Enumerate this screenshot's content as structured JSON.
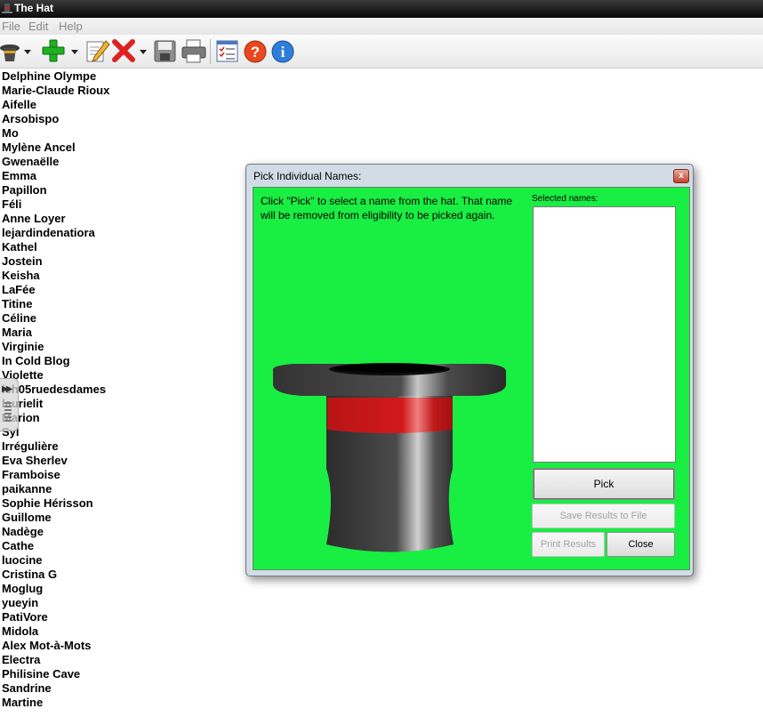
{
  "window": {
    "title": "The Hat"
  },
  "menu": [
    "File",
    "Edit",
    "Help"
  ],
  "toolbar": {
    "icons": [
      "hat-dropdown-icon",
      "add-icon",
      "edit-icon",
      "delete-icon",
      "save-icon",
      "print-icon",
      "checklist-icon",
      "help-icon",
      "info-icon"
    ]
  },
  "names": [
    "Delphine Olympe",
    "Marie-Claude Rioux",
    "Aifelle",
    "Arsobispo",
    "Mo",
    "Mylène Ancel",
    "Gwenaëlle",
    "Emma",
    "Papillon",
    "Féli",
    "Anne Loyer",
    "lejardindenatiora",
    "Kathel",
    "Jostein",
    "Keisha",
    "LaFée",
    "Titine",
    "Céline",
    "Maria",
    "Virginie",
    "In Cold Blog",
    "Violette",
    "ich05ruedesdames",
    "laurielit",
    "Marion",
    "Syl",
    "Irrégulière",
    "Eva Sherlev",
    "Framboise",
    "paikanne",
    "Sophie Hérisson",
    "Guillome",
    "Nadège",
    "Cathe",
    "luocine",
    "Cristina G",
    "Moglug",
    "yueyin",
    "PatiVore",
    "Midola",
    "Alex Mot-à-Mots",
    "Electra",
    "Philisine Cave",
    "Sandrine",
    "Martine"
  ],
  "dialog": {
    "title": "Pick Individual Names:",
    "close_glyph": "x",
    "instructions": "Click \"Pick\" to select a name from the hat. That name will be removed from eligibility to be picked again.",
    "selected_label": "Selected names:",
    "pick_label": "Pick",
    "save_label": "Save Results to File",
    "print_label": "Print Results",
    "close_label": "Close"
  },
  "colors": {
    "dialog_bg": "#19ee43",
    "hat_band": "#d2191b",
    "hat_body": "#3c3c3c"
  }
}
